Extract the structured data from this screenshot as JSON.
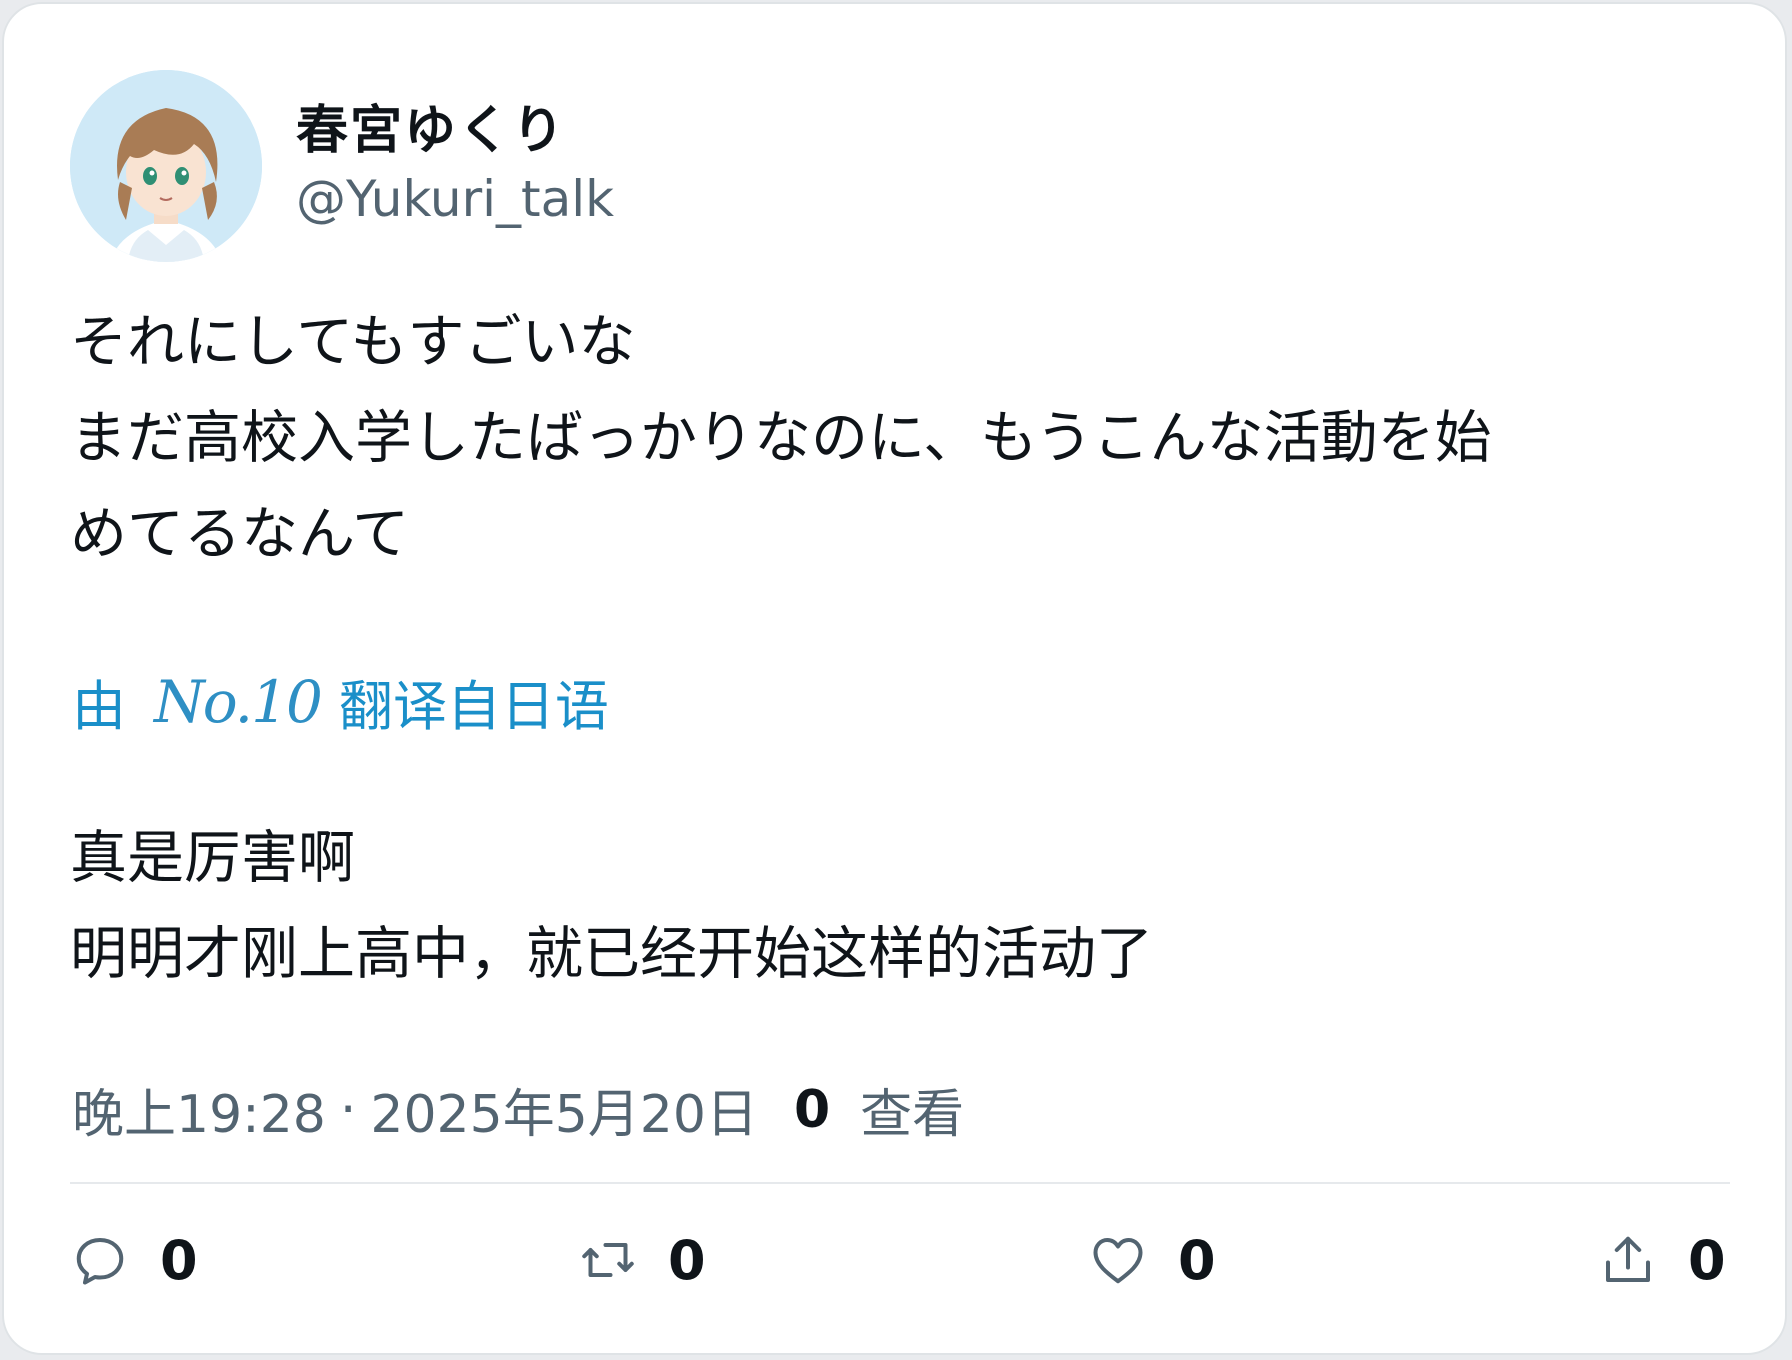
{
  "author": {
    "display_name": "春宮ゆくり",
    "handle": "@Yukuri_talk",
    "avatar_icon": "anime-avatar-icon"
  },
  "post": {
    "original_lines": [
      "それにしてもすごいな",
      "まだ高校入学したばっかりなのに、もうこんな活動を始",
      "めてるなんて"
    ],
    "translation_prefix": "由",
    "translator_name": "No.10",
    "translation_suffix": "翻译自日语",
    "translated_lines": [
      "真是厉害啊",
      "明明才刚上高中，就已经开始这样的活动了"
    ]
  },
  "meta": {
    "time": "晚上19:28",
    "separator": "·",
    "date": "2025年5月20日",
    "views_count": "0",
    "views_label": "查看"
  },
  "actions": {
    "reply": {
      "icon": "reply-icon",
      "count": "0"
    },
    "retweet": {
      "icon": "retweet-icon",
      "count": "0"
    },
    "like": {
      "icon": "heart-icon",
      "count": "0"
    },
    "share": {
      "icon": "share-icon",
      "count": "0"
    }
  },
  "colors": {
    "text": "#0f1419",
    "secondary": "#536471",
    "link": "#1a8fc9",
    "border": "#dfe3e6"
  }
}
